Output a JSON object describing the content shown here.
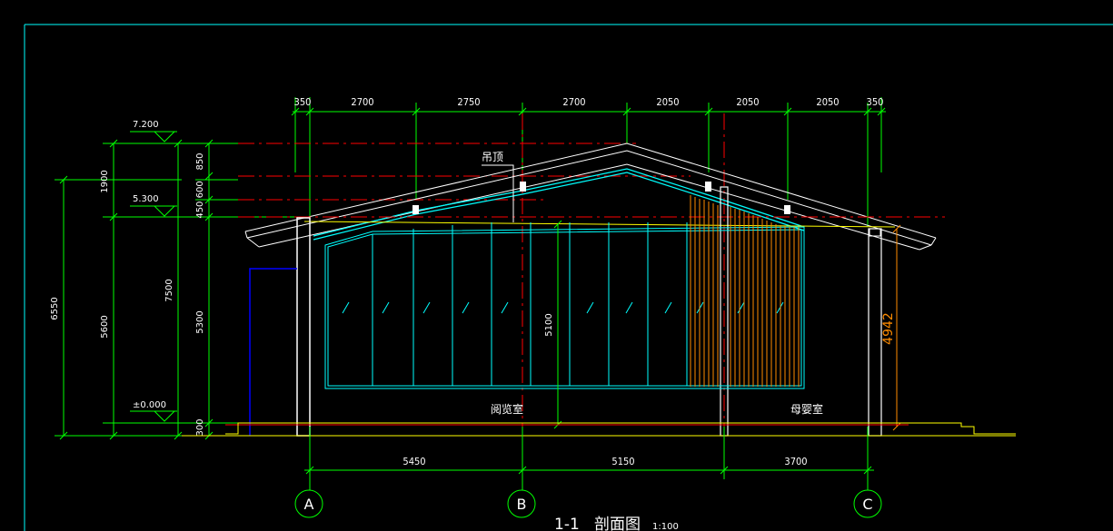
{
  "top_dims": [
    "350",
    "2700",
    "2750",
    "2700",
    "2050",
    "2050",
    "2050",
    "350"
  ],
  "bottom_dims": [
    "5450",
    "5150",
    "3700"
  ],
  "levels": {
    "top": "7.200",
    "eave": "5.300",
    "ground": "±0.000"
  },
  "left_dims": {
    "total": "6550",
    "mid": "5600",
    "upper": "1900",
    "mid2": "7500",
    "seg850": "850",
    "seg600": "450  600",
    "seg5300": "5300",
    "seg300": "300"
  },
  "interior_height": "5100",
  "right_dim": "4942",
  "ceiling_label": "吊顶",
  "rooms": {
    "reading": "阅览室",
    "nursing": "母婴室"
  },
  "axes": [
    "A",
    "B",
    "C"
  ],
  "title": "1-1   剖面图",
  "scale": "1:100",
  "colors": {
    "background": "#000000",
    "dimension_line": "#00ff00",
    "frame": "#00ffff",
    "wall": "#ffffff",
    "centerline": "#ff0000",
    "glass": "#00ffff",
    "ceiling": "#ffff00",
    "orange_dim": "#ff8c00",
    "door_blue": "#0000ff"
  }
}
